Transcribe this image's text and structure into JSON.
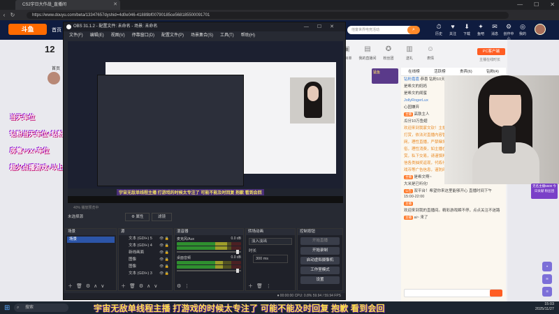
{
  "browser": {
    "tab_title": "CS2宇日大作战_直播间",
    "url": "https://www.douyu.com/beta/13347657dyshid=4d0e046-41889bf00790185ce568185500091701",
    "window_controls": [
      "—",
      "☐",
      "✕"
    ]
  },
  "site": {
    "logo_text": "斗鱼",
    "home_label": "首页",
    "search_placeholder": "他童世界电竞活动",
    "search_icon": "search-icon",
    "nav_icons": [
      {
        "glyph": "⏱",
        "label": "历史"
      },
      {
        "glyph": "♥",
        "label": "关注"
      },
      {
        "glyph": "⬇",
        "label": "下载"
      },
      {
        "glyph": "✦",
        "label": "鱼吧"
      },
      {
        "glyph": "✉",
        "label": "消息"
      },
      {
        "glyph": "⚙",
        "label": "创作中心"
      },
      {
        "glyph": "◎",
        "label": "我的"
      }
    ],
    "date_day": "12",
    "home_tag": "首页",
    "stickers": [
      "当天车位",
      "钻粉当天车位+钻粉群",
      "房管+vx+车位",
      "超火点播游戏+以上"
    ],
    "room_top": [
      {
        "glyph": "▣",
        "label": "节目单"
      },
      {
        "glyph": "▤",
        "label": "我的直播间"
      },
      {
        "glyph": "✪",
        "label": "粉丝团"
      },
      {
        "glyph": "▥",
        "label": "送礼"
      },
      {
        "glyph": "☺",
        "label": "表情"
      }
    ],
    "pc_button": "PC客户端",
    "pc_sub": "主播在线时长",
    "ad_text": "猛鱼",
    "side_tabs": [
      "在线榜",
      "活跃榜",
      "贵宾(6)",
      "钻粉(4)"
    ],
    "chat_lines": [
      {
        "user": "钻粉嘉嘉",
        "text": "恭喜 钻粉10天上位"
      },
      {
        "user": "",
        "text": "是希文的妈妈"
      },
      {
        "user": "",
        "text": "是希文的闺蜜"
      },
      {
        "user": "JollyRogerLux",
        "text": ""
      },
      {
        "user": "",
        "text": "心园嫌弃"
      },
      {
        "user": "主播",
        "text": "高铁主人"
      },
      {
        "user": "",
        "text": "瓜分10万鱼翅"
      },
      {
        "user": "",
        "text": "欢迎来到我家文钦！主播开播，请"
      },
      {
        "user": "",
        "text": "打赏，依法对直播内容管理，请"
      },
      {
        "user": "",
        "text": "网，理性直播，严禁赌博，低"
      },
      {
        "user": "",
        "text": "俗，理性消费，如主播在直播时以不正当方式诱导打"
      },
      {
        "user": "",
        "text": "赏，私下交易，请谨慎判断，以防人身财产损失。请勿轻"
      },
      {
        "user": "",
        "text": "信各类抽奖返现，代练代玩，私下交易，购买礼包码，游"
      },
      {
        "user": "",
        "text": "戏币等广告信息，谨防网络诈骗。"
      },
      {
        "user": "主播",
        "text": "是希文啊~"
      },
      {
        "user": "",
        "text": "大米是已听化!"
      },
      {
        "user": "公告",
        "text": "双平台！希望你来这里能够开心 直播时间下午 15:00-22:00"
      },
      {
        "user": "主播",
        "text": ""
      },
      {
        "user": "",
        "text": "欢迎来到我的直播间。精彩游戏瞬不停，点点关注不迷路"
      },
      {
        "user": "主播",
        "text": "ai~ 来了"
      }
    ],
    "webcam_badge": "无名主播5600 今日贡献 粉丝团"
  },
  "obs": {
    "title": "OBS 31.1.2 - 配置文件: 未命名 - 场景: 未命名",
    "menu": [
      "文件(F)",
      "编辑(E)",
      "视图(V)",
      "停靠窗口(D)",
      "配置文件(P)",
      "场景集合(S)",
      "工具(T)",
      "帮助(H)"
    ],
    "preview_caption": "宇宙无敌单线程主播 打游戏的时候太专注了 可能不能及时回复 抱歉 看到会回",
    "zoom_line": "40%    播放预览中",
    "toolbar": {
      "no_source": "未选择源",
      "properties": "⚙ 属性",
      "filters": "滤镜"
    },
    "docks": {
      "scenes": {
        "title": "场景",
        "items": [
          "场景"
        ],
        "selected": "场景"
      },
      "sources": {
        "title": "源",
        "items": [
          "文本 (GDI+) 5",
          "文本 (GDI+) 4",
          "新线画面",
          "图像",
          "图像",
          "文本 (GDI+) 3"
        ]
      },
      "mixer": {
        "title": "混音器",
        "channels": [
          {
            "name": "麦克风/Aux",
            "db": "0.0 dB",
            "level": 0.78,
            "volume": 0.92
          },
          {
            "name": "桌面音频",
            "db": "0.0 dB",
            "level": 0.72,
            "volume": 0.92
          }
        ]
      },
      "transitions": {
        "title": "转场动画",
        "type": "淡入淡出",
        "duration_label": "时长",
        "duration": "300 ms"
      },
      "controls": {
        "title": "控制按钮",
        "buttons": [
          "开始直播",
          "开始录制",
          "启动虚拟摄像机",
          "工作室模式",
          "设置"
        ]
      }
    },
    "status": "⏺ 00:00:00   CPU: 0.8%   59.94 / 59.94 FPS"
  },
  "caption": "宇宙无敌单线程主播 打游戏的时候太专注了 可能不能及时回复 抱歉 看到会回",
  "taskbar": {
    "search": "搜索",
    "time": "15:03",
    "date": "2025/11/27"
  }
}
